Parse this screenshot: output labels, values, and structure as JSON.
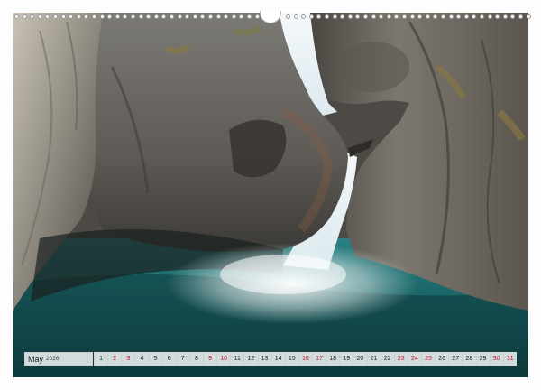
{
  "calendar": {
    "month": "May",
    "year": "2026",
    "days": [
      {
        "n": "1",
        "red": false
      },
      {
        "n": "2",
        "red": true
      },
      {
        "n": "3",
        "red": true
      },
      {
        "n": "4",
        "red": false
      },
      {
        "n": "5",
        "red": false
      },
      {
        "n": "6",
        "red": false
      },
      {
        "n": "7",
        "red": false
      },
      {
        "n": "8",
        "red": false
      },
      {
        "n": "9",
        "red": true
      },
      {
        "n": "10",
        "red": true
      },
      {
        "n": "11",
        "red": false
      },
      {
        "n": "12",
        "red": false
      },
      {
        "n": "13",
        "red": false
      },
      {
        "n": "14",
        "red": false
      },
      {
        "n": "15",
        "red": false
      },
      {
        "n": "16",
        "red": true
      },
      {
        "n": "17",
        "red": true
      },
      {
        "n": "18",
        "red": false
      },
      {
        "n": "19",
        "red": false
      },
      {
        "n": "20",
        "red": false
      },
      {
        "n": "21",
        "red": false
      },
      {
        "n": "22",
        "red": false
      },
      {
        "n": "23",
        "red": true
      },
      {
        "n": "24",
        "red": true
      },
      {
        "n": "25",
        "red": true
      },
      {
        "n": "26",
        "red": false
      },
      {
        "n": "27",
        "red": false
      },
      {
        "n": "28",
        "red": false
      },
      {
        "n": "29",
        "red": false
      },
      {
        "n": "30",
        "red": true
      },
      {
        "n": "31",
        "red": true
      }
    ]
  },
  "photo": {
    "subject": "waterfall-canyon-photo",
    "colors": {
      "rock_light": "#a8a49c",
      "rock_mid": "#6f6c66",
      "rock_dark": "#3a3835",
      "water_teal": "#1f6f6f",
      "water_deep": "#0e3a3c",
      "falls": "#eef4f6",
      "moss": "#8a7a3a"
    }
  },
  "weekend_color": "#c8102e"
}
